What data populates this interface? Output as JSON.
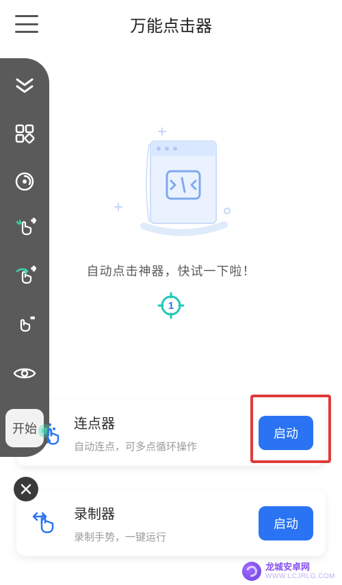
{
  "header": {
    "title": "万能点击器"
  },
  "sidebar": {
    "start_label": "开始"
  },
  "main": {
    "prompt": "自动点击神器，快试一下啦！",
    "marker_number": "1"
  },
  "cards": [
    {
      "title": "连点器",
      "subtitle": "自动连点，可多点循环操作",
      "action": "启动",
      "highlighted": true,
      "icon": "tap-cursor"
    },
    {
      "title": "录制器",
      "subtitle": "录制手势，一键运行",
      "action": "启动",
      "highlighted": false,
      "icon": "swipe-gesture"
    }
  ],
  "watermark": {
    "line1": "龙城安卓网",
    "line2": "WWW.LCJRLG.COM"
  }
}
